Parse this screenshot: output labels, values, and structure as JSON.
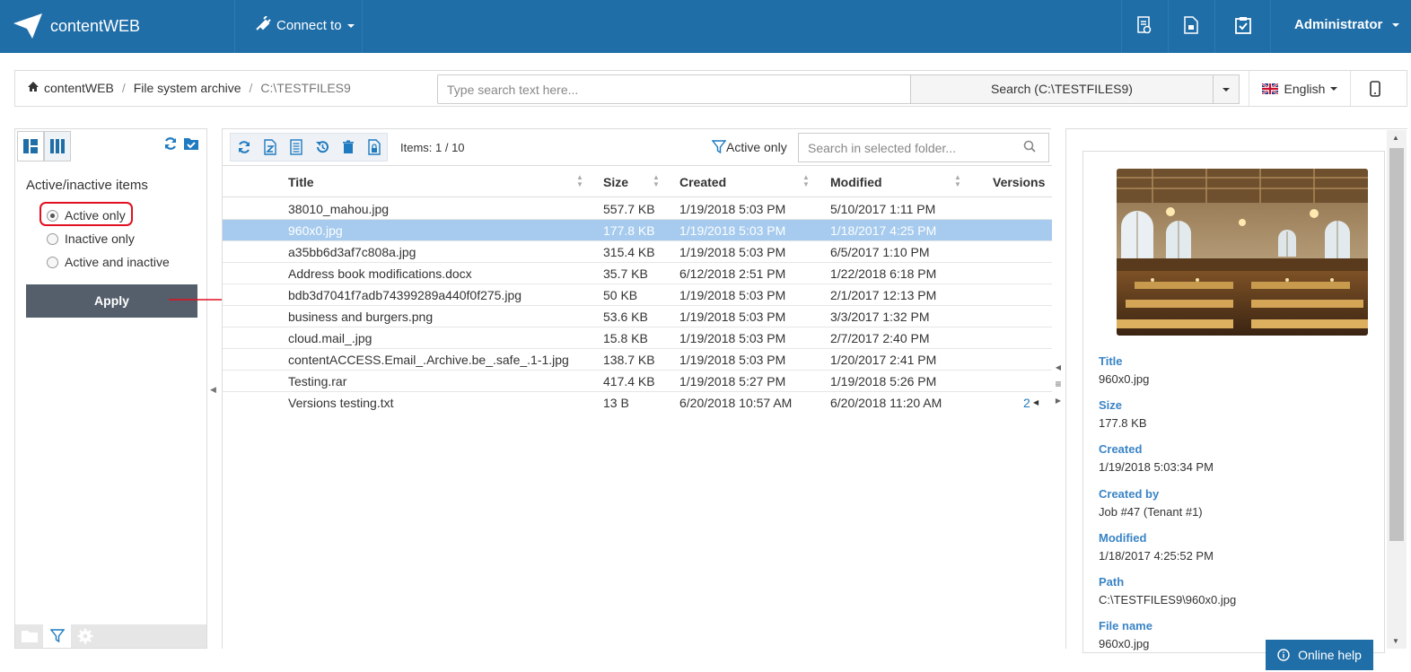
{
  "app": {
    "brand": "contentWEB",
    "connect_label": "Connect to",
    "user": "Administrator",
    "top_icons": [
      "report-icon",
      "document-icon",
      "clipboard-check-icon"
    ]
  },
  "breadcrumb": {
    "home": "contentWEB",
    "section": "File system archive",
    "current": "C:\\TESTFILES9"
  },
  "search": {
    "placeholder": "Type search text here...",
    "button": "Search (C:\\TESTFILES9)"
  },
  "language": "English",
  "filter_panel": {
    "title": "Active/inactive items",
    "options": [
      "Active only",
      "Inactive only",
      "Active and inactive"
    ],
    "selected": "Active only",
    "apply": "Apply"
  },
  "list": {
    "items_count": "Items: 1 / 10",
    "active_filter": "Active only",
    "folder_search_placeholder": "Search in selected folder...",
    "columns": {
      "title": "Title",
      "size": "Size",
      "created": "Created",
      "modified": "Modified",
      "versions": "Versions"
    },
    "rows": [
      {
        "title": "38010_mahou.jpg",
        "size": "557.7 KB",
        "created": "1/19/2018 5:03 PM",
        "modified": "5/10/2017 1:11 PM",
        "versions": ""
      },
      {
        "title": "960x0.jpg",
        "size": "177.8 KB",
        "created": "1/19/2018 5:03 PM",
        "modified": "1/18/2017 4:25 PM",
        "versions": ""
      },
      {
        "title": "a35bb6d3af7c808a.jpg",
        "size": "315.4 KB",
        "created": "1/19/2018 5:03 PM",
        "modified": "6/5/2017 1:10 PM",
        "versions": ""
      },
      {
        "title": "Address book modifications.docx",
        "size": "35.7 KB",
        "created": "6/12/2018 2:51 PM",
        "modified": "1/22/2018 6:18 PM",
        "versions": ""
      },
      {
        "title": "bdb3d7041f7adb74399289a440f0f275.jpg",
        "size": "50 KB",
        "created": "1/19/2018 5:03 PM",
        "modified": "2/1/2017 12:13 PM",
        "versions": ""
      },
      {
        "title": "business and burgers.png",
        "size": "53.6 KB",
        "created": "1/19/2018 5:03 PM",
        "modified": "3/3/2017 1:32 PM",
        "versions": ""
      },
      {
        "title": "cloud.mail_.jpg",
        "size": "15.8 KB",
        "created": "1/19/2018 5:03 PM",
        "modified": "2/7/2017 2:40 PM",
        "versions": ""
      },
      {
        "title": "contentACCESS.Email_.Archive.be_.safe_.1-1.jpg",
        "size": "138.7 KB",
        "created": "1/19/2018 5:03 PM",
        "modified": "1/20/2017 2:41 PM",
        "versions": ""
      },
      {
        "title": "Testing.rar",
        "size": "417.4 KB",
        "created": "1/19/2018 5:27 PM",
        "modified": "1/19/2018 5:26 PM",
        "versions": ""
      },
      {
        "title": "Versions testing.txt",
        "size": "13 B",
        "created": "6/20/2018 10:57 AM",
        "modified": "6/20/2018 11:20 AM",
        "versions": "2"
      }
    ],
    "selected_index": 1
  },
  "details": {
    "fields": [
      {
        "label": "Title",
        "value": "960x0.jpg"
      },
      {
        "label": "Size",
        "value": "177.8 KB"
      },
      {
        "label": "Created",
        "value": "1/19/2018 5:03:34 PM"
      },
      {
        "label": "Created by",
        "value": "Job #47 (Tenant #1)"
      },
      {
        "label": "Modified",
        "value": "1/18/2017 4:25:52 PM"
      },
      {
        "label": "Path",
        "value": "C:\\TESTFILES9\\960x0.jpg"
      },
      {
        "label": "File name",
        "value": "960x0.jpg"
      }
    ]
  },
  "help": "Online help",
  "colors": {
    "navbar": "#1f6ea8",
    "accent": "#3a84c6",
    "selected_row": "#a6cbee",
    "apply_button": "#555f6b",
    "highlight": "#e01020"
  }
}
